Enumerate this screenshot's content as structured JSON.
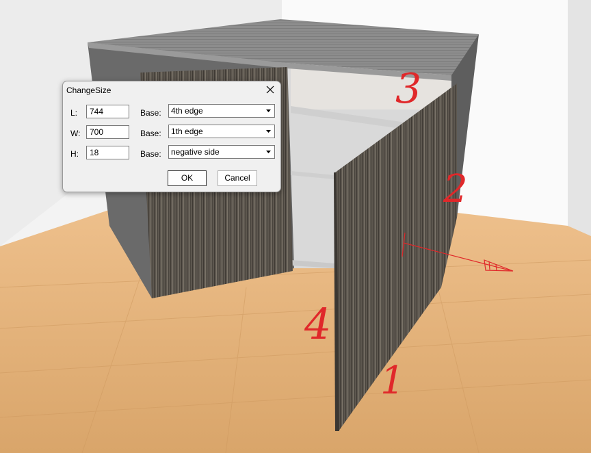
{
  "scene": {
    "annotations": [
      "1",
      "2",
      "3",
      "4"
    ],
    "colors": {
      "floor": "#e3b27a",
      "wall": "#f4f4f4",
      "wood": "#5c564e",
      "carcass": "#6d6d6d",
      "annotation": "#e0282a"
    }
  },
  "dialog": {
    "title": "ChangeSize",
    "close_icon": "close-icon",
    "rows": [
      {
        "label": "L:",
        "value": "744",
        "base_label": "Base:",
        "base": "4th edge"
      },
      {
        "label": "W:",
        "value": "700",
        "base_label": "Base:",
        "base": "1th edge"
      },
      {
        "label": "H:",
        "value": "18",
        "base_label": "Base:",
        "base": "negative side"
      }
    ],
    "ok_label": "OK",
    "cancel_label": "Cancel"
  }
}
